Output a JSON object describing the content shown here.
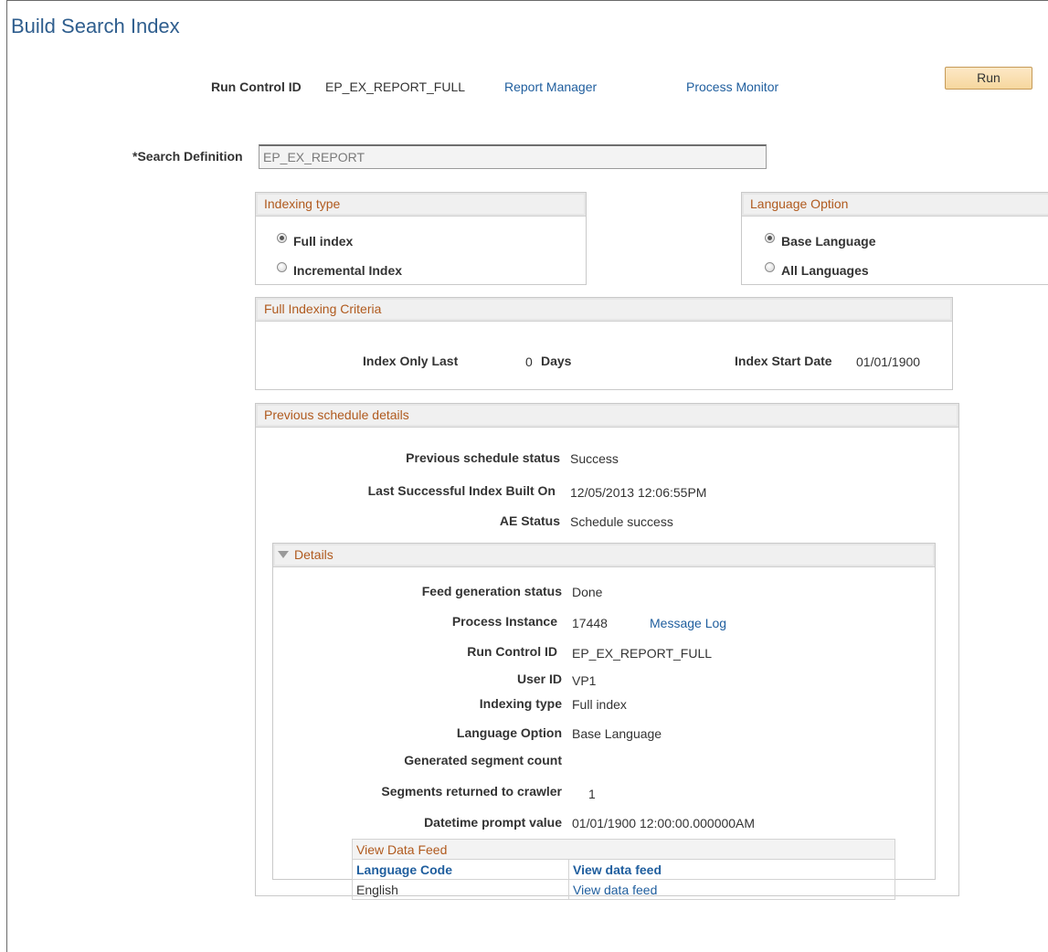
{
  "page": {
    "title": "Build Search Index"
  },
  "run_control": {
    "label": "Run Control ID",
    "value": "EP_EX_REPORT_FULL",
    "report_manager": "Report Manager",
    "process_monitor": "Process Monitor",
    "run_button": "Run"
  },
  "search_definition": {
    "label": "*Search Definition",
    "value": "EP_EX_REPORT"
  },
  "indexing_type": {
    "title": "Indexing type",
    "options": [
      "Full index",
      "Incremental Index"
    ],
    "selected": "Full index"
  },
  "language_option": {
    "title": "Language Option",
    "options": [
      "Base Language",
      "All Languages"
    ],
    "selected": "Base Language"
  },
  "full_indexing_criteria": {
    "title": "Full Indexing Criteria",
    "index_only_last_label": "Index Only Last",
    "index_only_last_value": "0",
    "days_label": "Days",
    "index_start_date_label": "Index Start Date",
    "index_start_date_value": "01/01/1900"
  },
  "previous_schedule": {
    "title": "Previous schedule details",
    "status_label": "Previous schedule status",
    "status_value": "Success",
    "last_built_label": "Last Successful Index Built On",
    "last_built_value": "12/05/2013 12:06:55PM",
    "ae_status_label": "AE Status",
    "ae_status_value": "Schedule success"
  },
  "details": {
    "title": "Details",
    "feed_status_label": "Feed generation status",
    "feed_status_value": "Done",
    "process_instance_label": "Process Instance",
    "process_instance_value": "17448",
    "message_log": "Message Log",
    "run_control_label": "Run Control ID",
    "run_control_value": "EP_EX_REPORT_FULL",
    "user_id_label": "User ID",
    "user_id_value": "VP1",
    "indexing_type_label": "Indexing type",
    "indexing_type_value": "Full index",
    "language_option_label": "Language Option",
    "language_option_value": "Base Language",
    "segment_count_label": "Generated segment count",
    "segments_returned_label": "Segments returned to crawler",
    "segments_returned_value": "1",
    "datetime_prompt_label": "Datetime prompt value",
    "datetime_prompt_value": "01/01/1900 12:00:00.000000AM"
  },
  "view_data_feed": {
    "title": "View Data Feed",
    "columns": [
      "Language Code",
      "View data feed"
    ],
    "rows": [
      {
        "language_code": "English",
        "link": "View data feed"
      }
    ]
  }
}
